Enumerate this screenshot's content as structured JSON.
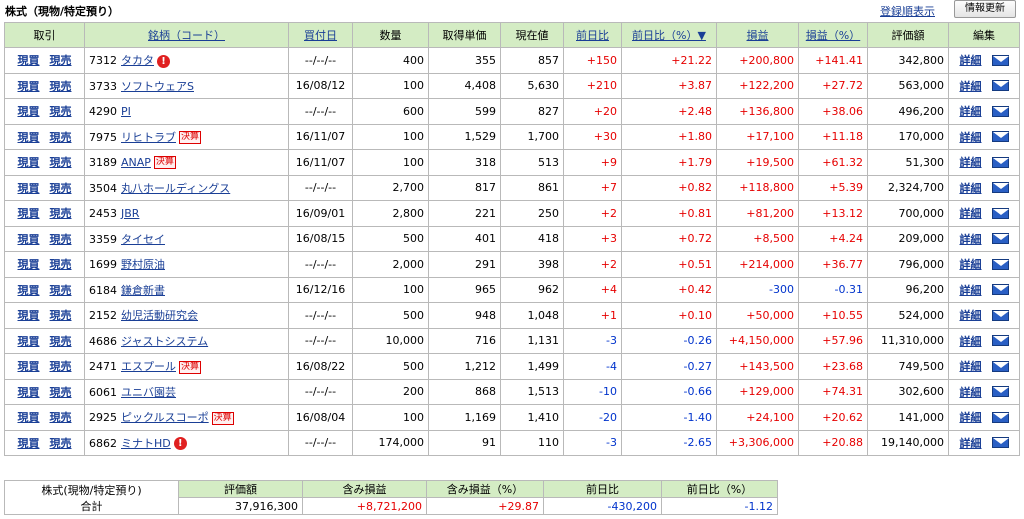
{
  "header": {
    "title": "株式（現物/特定預り）",
    "sort_link": "登録順表示",
    "refresh_button": "情報更新"
  },
  "columns": {
    "trade": "取引",
    "stock": "銘柄（コード）",
    "purchase_date": "買付日",
    "quantity": "数量",
    "acquisition_price": "取得単価",
    "current_price": "現在値",
    "change": "前日比",
    "change_pct": "前日比（%）▼",
    "profit_loss": "損益",
    "profit_loss_pct": "損益（%）",
    "valuation": "評価額",
    "edit": "編集"
  },
  "actions": {
    "buy": "現買",
    "sell": "現売",
    "detail": "詳細"
  },
  "icons": {
    "alert": "alert-icon",
    "mail": "mail-icon"
  },
  "colors": {
    "header_bg": "#d4ecc4",
    "positive": "#e60000",
    "negative": "#0033cc",
    "link": "#1a3f96"
  },
  "rows": [
    {
      "code": "7312",
      "name": "タカタ",
      "badge": "",
      "alert": true,
      "date": "--/--/--",
      "qty": "400",
      "cost": "355",
      "price": "857",
      "chg": "+150",
      "chg_pct": "+21.22",
      "pl": "+200,800",
      "pl_pct": "+141.41",
      "value": "342,800"
    },
    {
      "code": "3733",
      "name": "ソフトウェアS",
      "badge": "",
      "alert": false,
      "date": "16/08/12",
      "qty": "100",
      "cost": "4,408",
      "price": "5,630",
      "chg": "+210",
      "chg_pct": "+3.87",
      "pl": "+122,200",
      "pl_pct": "+27.72",
      "value": "563,000"
    },
    {
      "code": "4290",
      "name": "PI",
      "badge": "",
      "alert": false,
      "date": "--/--/--",
      "qty": "600",
      "cost": "599",
      "price": "827",
      "chg": "+20",
      "chg_pct": "+2.48",
      "pl": "+136,800",
      "pl_pct": "+38.06",
      "value": "496,200"
    },
    {
      "code": "7975",
      "name": "リヒトラブ",
      "badge": "決算",
      "alert": false,
      "date": "16/11/07",
      "qty": "100",
      "cost": "1,529",
      "price": "1,700",
      "chg": "+30",
      "chg_pct": "+1.80",
      "pl": "+17,100",
      "pl_pct": "+11.18",
      "value": "170,000"
    },
    {
      "code": "3189",
      "name": "ANAP",
      "badge": "決算",
      "alert": false,
      "date": "16/11/07",
      "qty": "100",
      "cost": "318",
      "price": "513",
      "chg": "+9",
      "chg_pct": "+1.79",
      "pl": "+19,500",
      "pl_pct": "+61.32",
      "value": "51,300"
    },
    {
      "code": "3504",
      "name": "丸八ホールディングス",
      "badge": "",
      "alert": false,
      "date": "--/--/--",
      "qty": "2,700",
      "cost": "817",
      "price": "861",
      "chg": "+7",
      "chg_pct": "+0.82",
      "pl": "+118,800",
      "pl_pct": "+5.39",
      "value": "2,324,700"
    },
    {
      "code": "2453",
      "name": "JBR",
      "badge": "",
      "alert": false,
      "date": "16/09/01",
      "qty": "2,800",
      "cost": "221",
      "price": "250",
      "chg": "+2",
      "chg_pct": "+0.81",
      "pl": "+81,200",
      "pl_pct": "+13.12",
      "value": "700,000"
    },
    {
      "code": "3359",
      "name": "タイセイ",
      "badge": "",
      "alert": false,
      "date": "16/08/15",
      "qty": "500",
      "cost": "401",
      "price": "418",
      "chg": "+3",
      "chg_pct": "+0.72",
      "pl": "+8,500",
      "pl_pct": "+4.24",
      "value": "209,000"
    },
    {
      "code": "1699",
      "name": "野村原油",
      "badge": "",
      "alert": false,
      "date": "--/--/--",
      "qty": "2,000",
      "cost": "291",
      "price": "398",
      "chg": "+2",
      "chg_pct": "+0.51",
      "pl": "+214,000",
      "pl_pct": "+36.77",
      "value": "796,000"
    },
    {
      "code": "6184",
      "name": "鎌倉新書",
      "badge": "",
      "alert": false,
      "date": "16/12/16",
      "qty": "100",
      "cost": "965",
      "price": "962",
      "chg": "+4",
      "chg_pct": "+0.42",
      "pl": "-300",
      "pl_pct": "-0.31",
      "value": "96,200"
    },
    {
      "code": "2152",
      "name": "幼児活動研究会",
      "badge": "",
      "alert": false,
      "date": "--/--/--",
      "qty": "500",
      "cost": "948",
      "price": "1,048",
      "chg": "+1",
      "chg_pct": "+0.10",
      "pl": "+50,000",
      "pl_pct": "+10.55",
      "value": "524,000"
    },
    {
      "code": "4686",
      "name": "ジャストシステム",
      "badge": "",
      "alert": false,
      "date": "--/--/--",
      "qty": "10,000",
      "cost": "716",
      "price": "1,131",
      "chg": "-3",
      "chg_pct": "-0.26",
      "pl": "+4,150,000",
      "pl_pct": "+57.96",
      "value": "11,310,000"
    },
    {
      "code": "2471",
      "name": "エスプール",
      "badge": "決算",
      "alert": false,
      "date": "16/08/22",
      "qty": "500",
      "cost": "1,212",
      "price": "1,499",
      "chg": "-4",
      "chg_pct": "-0.27",
      "pl": "+143,500",
      "pl_pct": "+23.68",
      "value": "749,500"
    },
    {
      "code": "6061",
      "name": "ユニバ園芸",
      "badge": "",
      "alert": false,
      "date": "--/--/--",
      "qty": "200",
      "cost": "868",
      "price": "1,513",
      "chg": "-10",
      "chg_pct": "-0.66",
      "pl": "+129,000",
      "pl_pct": "+74.31",
      "value": "302,600"
    },
    {
      "code": "2925",
      "name": "ピックルスコーポ",
      "badge": "決算",
      "alert": false,
      "date": "16/08/04",
      "qty": "100",
      "cost": "1,169",
      "price": "1,410",
      "chg": "-20",
      "chg_pct": "-1.40",
      "pl": "+24,100",
      "pl_pct": "+20.62",
      "value": "141,000"
    },
    {
      "code": "6862",
      "name": "ミナトHD",
      "badge": "",
      "alert": true,
      "date": "--/--/--",
      "qty": "174,000",
      "cost": "91",
      "price": "110",
      "chg": "-3",
      "chg_pct": "-2.65",
      "pl": "+3,306,000",
      "pl_pct": "+20.88",
      "value": "19,140,000"
    }
  ],
  "summary": {
    "label_line1": "株式(現物/特定預り)",
    "label_line2": "合計",
    "headers": {
      "valuation": "評価額",
      "unrealized": "含み損益",
      "unrealized_pct": "含み損益（%）",
      "change": "前日比",
      "change_pct": "前日比（%）"
    },
    "valuation": "37,916,300",
    "unrealized": "+8,721,200",
    "unrealized_pct": "+29.87",
    "change": "-430,200",
    "change_pct": "-1.12"
  }
}
